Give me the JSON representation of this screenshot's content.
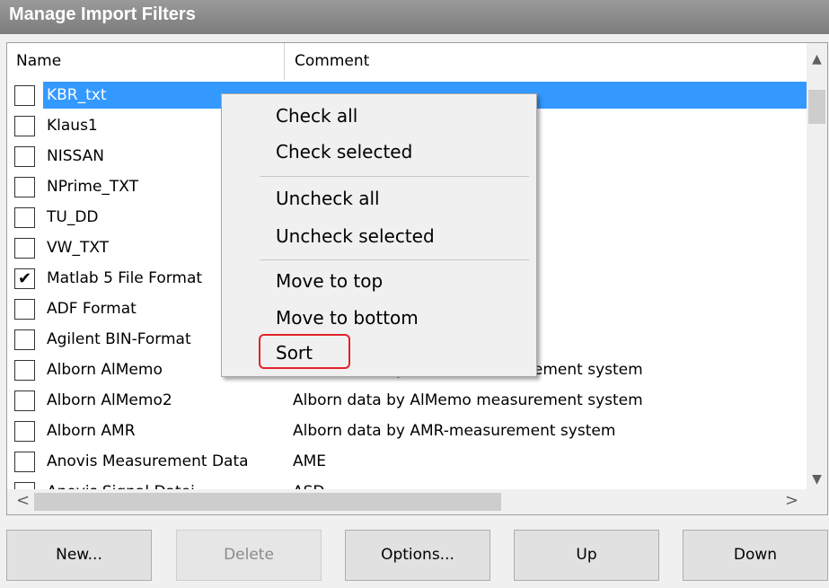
{
  "window": {
    "title": "Manage Import Filters"
  },
  "columns": {
    "name": "Name",
    "comment": "Comment"
  },
  "rows": [
    {
      "name": "KBR_txt",
      "comment": "",
      "checked": false,
      "selected": true
    },
    {
      "name": "Klaus1",
      "comment": "",
      "checked": false
    },
    {
      "name": "NISSAN",
      "comment": "",
      "checked": false
    },
    {
      "name": "NPrime_TXT",
      "comment": "",
      "checked": false
    },
    {
      "name": "TU_DD",
      "comment": "",
      "checked": false
    },
    {
      "name": "VW_TXT",
      "comment": "",
      "checked": false
    },
    {
      "name": "Matlab 5 File Format",
      "comment": "",
      "checked": true
    },
    {
      "name": "ADF Format",
      "comment": "",
      "checked": false
    },
    {
      "name": "Agilent BIN-Format",
      "comment": "",
      "checked": false
    },
    {
      "name": "Alborn AlMemo",
      "comment": "Alborn data by AlMemo measurement system",
      "checked": false
    },
    {
      "name": "Alborn AlMemo2",
      "comment": "Alborn data by AlMemo measurement system",
      "checked": false
    },
    {
      "name": "Alborn AMR",
      "comment": "Alborn data by AMR-measurement system",
      "checked": false
    },
    {
      "name": "Anovis Measurement Data",
      "comment": "AME",
      "checked": false
    },
    {
      "name": "Anovis Signal Datei",
      "comment": "ASD",
      "checked": false
    }
  ],
  "context_menu": {
    "check_all": "Check all",
    "check_selected": "Check selected",
    "uncheck_all": "Uncheck all",
    "uncheck_selected": "Uncheck selected",
    "move_to_top": "Move to top",
    "move_to_bottom": "Move to bottom",
    "sort": "Sort"
  },
  "buttons": {
    "new": "New...",
    "delete": "Delete",
    "options": "Options...",
    "up": "Up",
    "down": "Down"
  },
  "icons": {
    "scroll_up": "▲",
    "scroll_down": "▼",
    "scroll_left": "<",
    "scroll_right": ">",
    "check": "✔"
  },
  "colors": {
    "selection": "#3399ff",
    "highlight_border": "#e2222a"
  }
}
